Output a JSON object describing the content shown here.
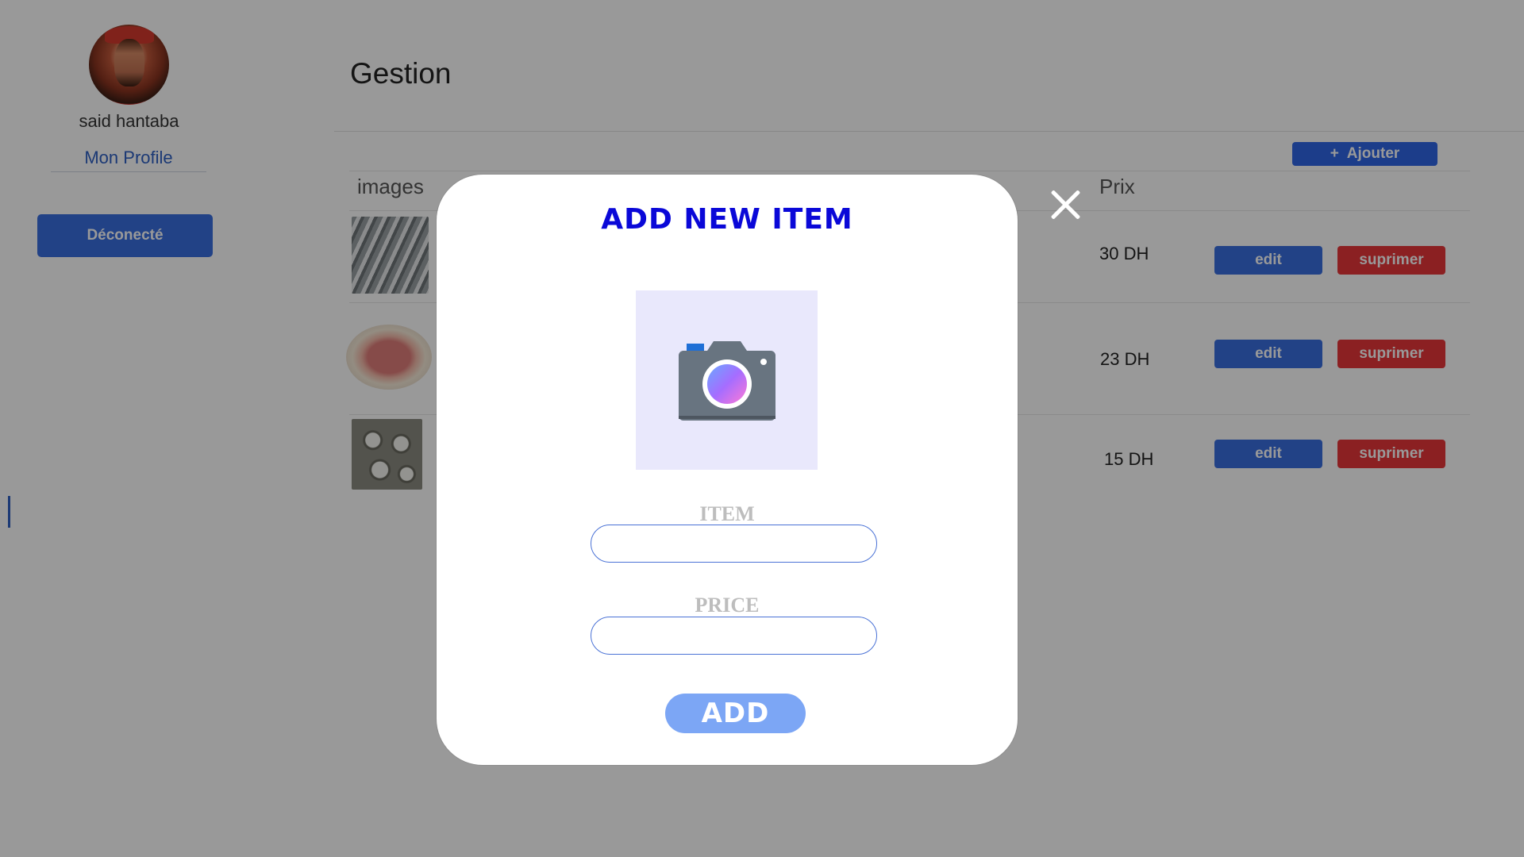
{
  "sidebar": {
    "user_name": "said hantaba",
    "profile_link": "Mon Profile",
    "logout_label": "Déconecté"
  },
  "main": {
    "title": "Gestion",
    "add_button": {
      "icon": "plus-icon",
      "label": "Ajouter"
    },
    "table": {
      "headers": {
        "images": "images",
        "prix": "Prix"
      },
      "rows": [
        {
          "image": "sardines-photo",
          "price": "30 DH",
          "edit_label": "edit",
          "delete_label": "suprimer"
        },
        {
          "image": "ham-slices-photo",
          "price": "23 DH",
          "edit_label": "edit",
          "delete_label": "suprimer"
        },
        {
          "image": "calamari-rings-photo",
          "price": "15 DH",
          "edit_label": "edit",
          "delete_label": "suprimer"
        }
      ]
    }
  },
  "modal": {
    "title": "ADD NEW ITEM",
    "image_icon": "camera-icon",
    "item_label": "ITEM",
    "item_value": "",
    "price_label": "PRICE",
    "price_value": "",
    "submit_label": "ADD",
    "close_icon": "close-icon"
  },
  "colors": {
    "primary_blue": "#3a6fe0",
    "danger_red": "#e8363a",
    "modal_title": "#0a08d8",
    "submit_button": "#7ca6f5",
    "overlay": "rgba(0,0,0,0.4)"
  }
}
